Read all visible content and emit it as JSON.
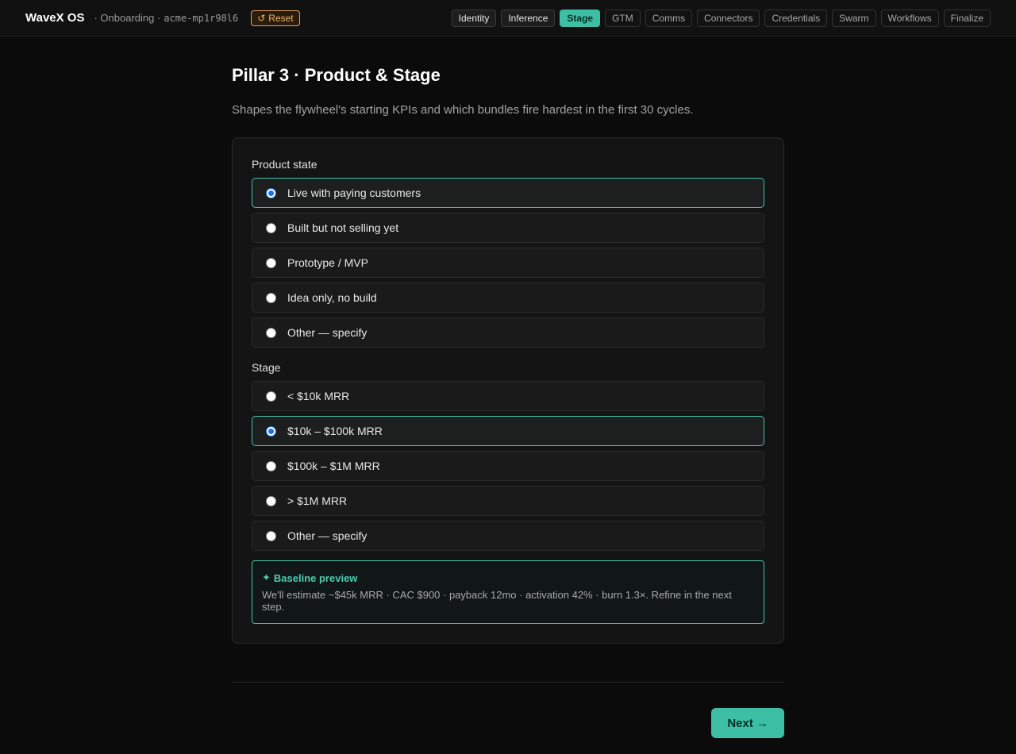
{
  "header": {
    "brand": "WaveX OS",
    "section": "· Onboarding ·",
    "workspace_id": "acme-mp1r98l6",
    "reset_icon": "↺",
    "reset_label": "Reset",
    "steps": [
      {
        "label": "Identity",
        "state": "done"
      },
      {
        "label": "Inference",
        "state": "done"
      },
      {
        "label": "Stage",
        "state": "active"
      },
      {
        "label": "GTM",
        "state": "todo"
      },
      {
        "label": "Comms",
        "state": "todo"
      },
      {
        "label": "Connectors",
        "state": "todo"
      },
      {
        "label": "Credentials",
        "state": "todo"
      },
      {
        "label": "Swarm",
        "state": "todo"
      },
      {
        "label": "Workflows",
        "state": "todo"
      },
      {
        "label": "Finalize",
        "state": "todo"
      }
    ]
  },
  "page": {
    "title": "Pillar 3 · Product & Stage",
    "subtitle": "Shapes the flywheel's starting KPIs and which bundles fire hardest in the first 30 cycles."
  },
  "product_state": {
    "label": "Product state",
    "selected_index": 0,
    "options": [
      "Live with paying customers",
      "Built but not selling yet",
      "Prototype / MVP",
      "Idea only, no build",
      "Other — specify"
    ]
  },
  "stage": {
    "label": "Stage",
    "selected_index": 1,
    "options": [
      "< $10k MRR",
      "$10k – $100k MRR",
      "$100k – $1M MRR",
      "> $1M MRR",
      "Other — specify"
    ]
  },
  "preview": {
    "icon": "✦",
    "title": "Baseline preview",
    "text": "We'll estimate ~$45k MRR · CAC $900 · payback 12mo · activation 42% · burn 1.3×. Refine in the next step."
  },
  "footer": {
    "next_label": "Next →"
  },
  "colors": {
    "accent": "#3dbfa5",
    "warning": "#f0b366",
    "background": "#0b0b0b"
  }
}
